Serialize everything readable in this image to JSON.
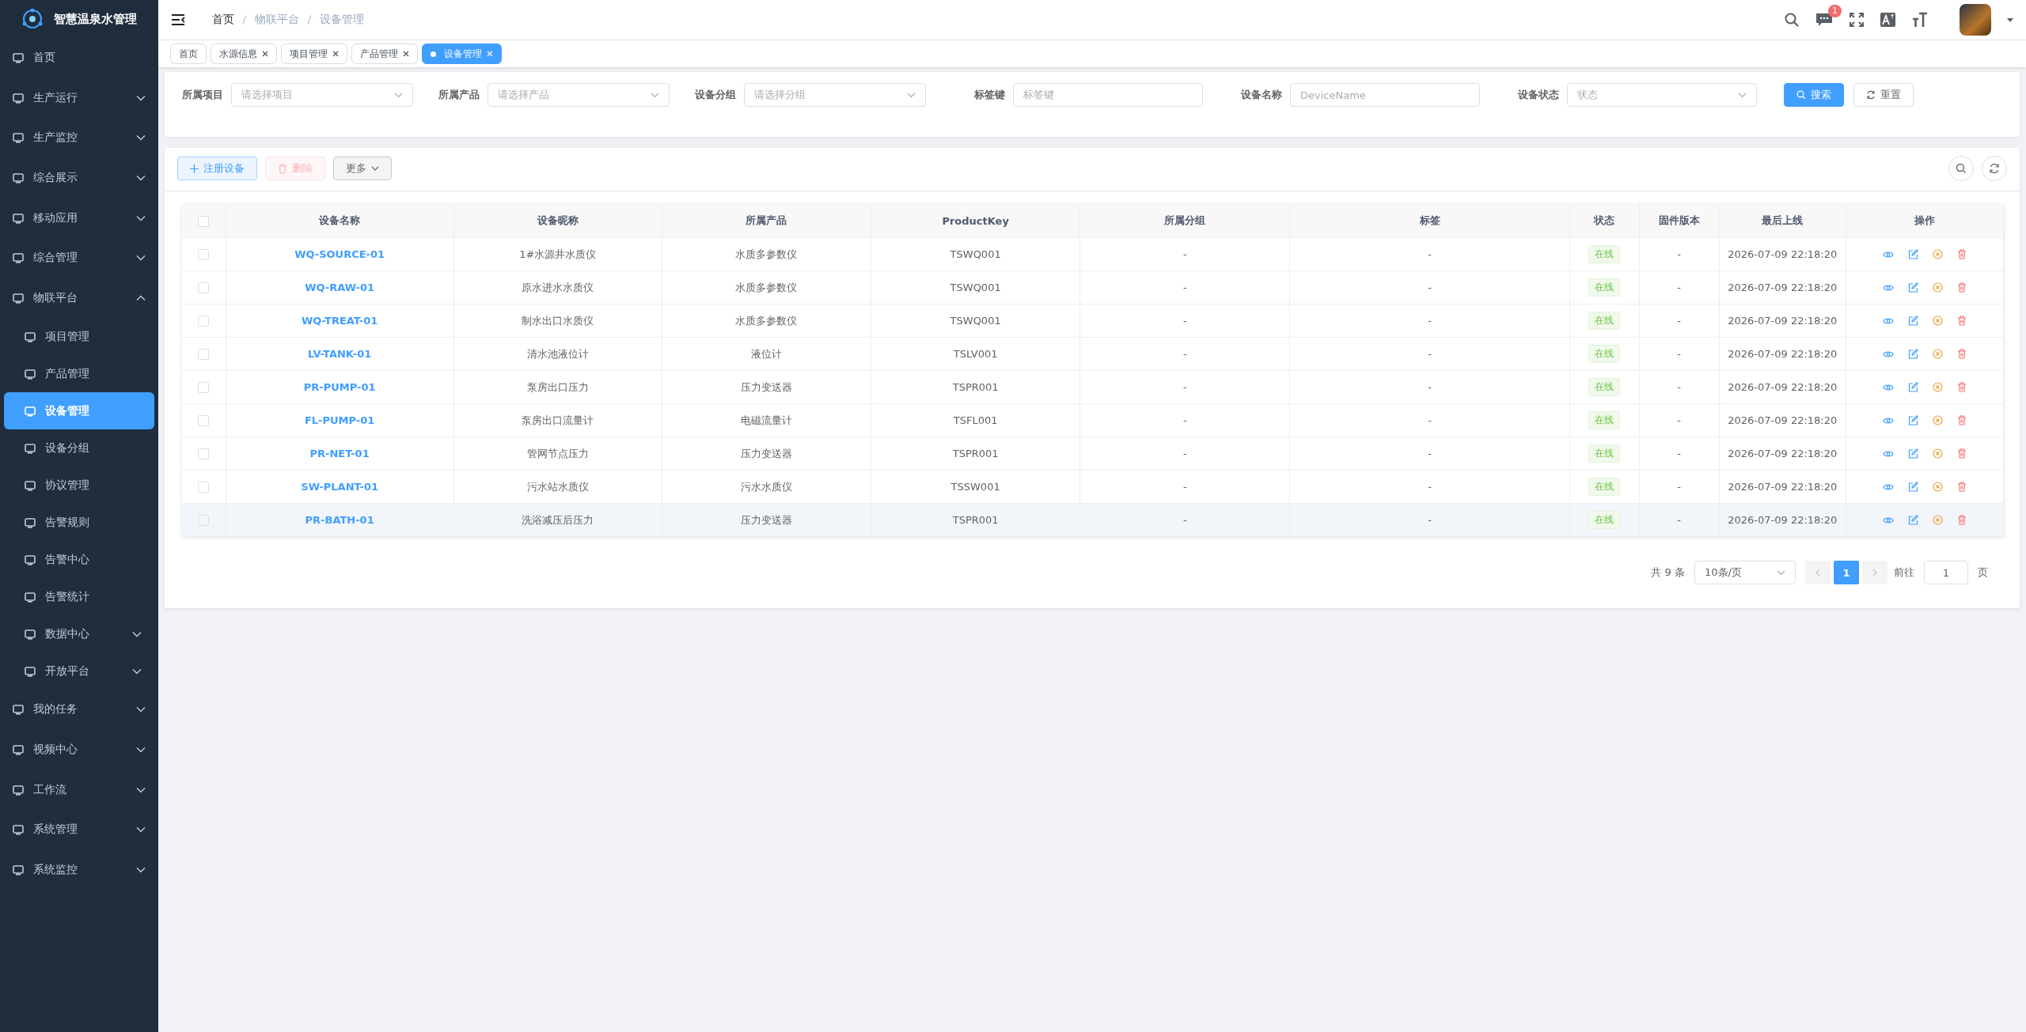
{
  "app": {
    "title": "智慧温泉水管理"
  },
  "sidebar": {
    "items": [
      {
        "label": "首页",
        "kind": "link"
      },
      {
        "label": "生产运行",
        "kind": "group",
        "expanded": false
      },
      {
        "label": "生产监控",
        "kind": "group",
        "expanded": false
      },
      {
        "label": "综合展示",
        "kind": "group",
        "expanded": false
      },
      {
        "label": "移动应用",
        "kind": "group",
        "expanded": false
      },
      {
        "label": "综合管理",
        "kind": "group",
        "expanded": false
      },
      {
        "label": "物联平台",
        "kind": "group",
        "expanded": true,
        "children": [
          {
            "label": "项目管理",
            "kind": "link",
            "selected": false
          },
          {
            "label": "产品管理",
            "kind": "link",
            "selected": false
          },
          {
            "label": "设备管理",
            "kind": "link",
            "selected": true
          },
          {
            "label": "设备分组",
            "kind": "link",
            "selected": false
          },
          {
            "label": "协议管理",
            "kind": "link",
            "selected": false
          },
          {
            "label": "告警规则",
            "kind": "link",
            "selected": false
          },
          {
            "label": "告警中心",
            "kind": "link",
            "selected": false
          },
          {
            "label": "告警统计",
            "kind": "link",
            "selected": false
          },
          {
            "label": "数据中心",
            "kind": "group",
            "expanded": false,
            "selected": false
          },
          {
            "label": "开放平台",
            "kind": "group",
            "expanded": false,
            "selected": false
          }
        ]
      },
      {
        "label": "我的任务",
        "kind": "group",
        "expanded": false
      },
      {
        "label": "视频中心",
        "kind": "group",
        "expanded": false
      },
      {
        "label": "工作流",
        "kind": "group",
        "expanded": false
      },
      {
        "label": "系统管理",
        "kind": "group",
        "expanded": false
      },
      {
        "label": "系统监控",
        "kind": "group",
        "expanded": false
      }
    ]
  },
  "header": {
    "breadcrumb": [
      "首页",
      "物联平台",
      "设备管理"
    ],
    "message_badge": "1"
  },
  "tabs": [
    {
      "label": "首页",
      "selected": false,
      "closable": false
    },
    {
      "label": "水源信息",
      "selected": false,
      "closable": true
    },
    {
      "label": "项目管理",
      "selected": false,
      "closable": true
    },
    {
      "label": "产品管理",
      "selected": false,
      "closable": true
    },
    {
      "label": "设备管理",
      "selected": true,
      "closable": true
    }
  ],
  "filters": [
    {
      "label": "所属项目",
      "placeholder": "请选择项目",
      "kind": "select"
    },
    {
      "label": "所属产品",
      "placeholder": "请选择产品",
      "kind": "select"
    },
    {
      "label": "设备分组",
      "placeholder": "请选择分组",
      "kind": "select"
    },
    {
      "label": "标签键",
      "placeholder": "标签键",
      "kind": "input"
    },
    {
      "label": "设备名称",
      "placeholder": "DeviceName",
      "kind": "input"
    },
    {
      "label": "设备状态",
      "placeholder": "状态",
      "kind": "select"
    }
  ],
  "filter_buttons": [
    {
      "label": "搜索",
      "kind": "primary"
    },
    {
      "label": "重置",
      "kind": "default"
    }
  ],
  "toolbar": [
    {
      "label": "注册设备",
      "kind": "add",
      "disabled": false
    },
    {
      "label": "删除",
      "kind": "delete",
      "disabled": true
    },
    {
      "label": "更多",
      "kind": "dropdown",
      "disabled": false
    }
  ],
  "table": {
    "select_all_checked": false,
    "columns": [
      "设备名称",
      "设备昵称",
      "所属产品",
      "ProductKey",
      "所属分组",
      "标签",
      "状态",
      "固件版本",
      "最后上线",
      "操作"
    ],
    "rows": [
      {
        "checked": false,
        "hovered": false,
        "name": "WQ-SOURCE-01",
        "nickname": "1#水源井水质仪",
        "product": "水质多参数仪",
        "product_key": "TSWQ001",
        "group": "-",
        "tag": "-",
        "status": "在线",
        "firmware": "-",
        "last_online": "2026-07-09 22:18:20"
      },
      {
        "checked": false,
        "hovered": false,
        "name": "WQ-RAW-01",
        "nickname": "原水进水水质仪",
        "product": "水质多参数仪",
        "product_key": "TSWQ001",
        "group": "-",
        "tag": "-",
        "status": "在线",
        "firmware": "-",
        "last_online": "2026-07-09 22:18:20"
      },
      {
        "checked": false,
        "hovered": false,
        "name": "WQ-TREAT-01",
        "nickname": "制水出口水质仪",
        "product": "水质多参数仪",
        "product_key": "TSWQ001",
        "group": "-",
        "tag": "-",
        "status": "在线",
        "firmware": "-",
        "last_online": "2026-07-09 22:18:20"
      },
      {
        "checked": false,
        "hovered": false,
        "name": "LV-TANK-01",
        "nickname": "清水池液位计",
        "product": "液位计",
        "product_key": "TSLV001",
        "group": "-",
        "tag": "-",
        "status": "在线",
        "firmware": "-",
        "last_online": "2026-07-09 22:18:20"
      },
      {
        "checked": false,
        "hovered": false,
        "name": "PR-PUMP-01",
        "nickname": "泵房出口压力",
        "product": "压力变送器",
        "product_key": "TSPR001",
        "group": "-",
        "tag": "-",
        "status": "在线",
        "firmware": "-",
        "last_online": "2026-07-09 22:18:20"
      },
      {
        "checked": false,
        "hovered": false,
        "name": "FL-PUMP-01",
        "nickname": "泵房出口流量计",
        "product": "电磁流量计",
        "product_key": "TSFL001",
        "group": "-",
        "tag": "-",
        "status": "在线",
        "firmware": "-",
        "last_online": "2026-07-09 22:18:20"
      },
      {
        "checked": false,
        "hovered": false,
        "name": "PR-NET-01",
        "nickname": "管网节点压力",
        "product": "压力变送器",
        "product_key": "TSPR001",
        "group": "-",
        "tag": "-",
        "status": "在线",
        "firmware": "-",
        "last_online": "2026-07-09 22:18:20"
      },
      {
        "checked": false,
        "hovered": false,
        "name": "SW-PLANT-01",
        "nickname": "污水站水质仪",
        "product": "污水水质仪",
        "product_key": "TSSW001",
        "group": "-",
        "tag": "-",
        "status": "在线",
        "firmware": "-",
        "last_online": "2026-07-09 22:18:20"
      },
      {
        "checked": false,
        "hovered": true,
        "name": "PR-BATH-01",
        "nickname": "洗浴减压后压力",
        "product": "压力变送器",
        "product_key": "TSPR001",
        "group": "-",
        "tag": "-",
        "status": "在线",
        "firmware": "-",
        "last_online": "2026-07-09 22:18:20"
      }
    ]
  },
  "pagination": {
    "total": "共 9 条",
    "page_size": "10条/页",
    "pages": [
      {
        "label": "1",
        "selected": true
      }
    ],
    "goto_label": "前往",
    "goto_value": "1",
    "goto_suffix": "页"
  }
}
